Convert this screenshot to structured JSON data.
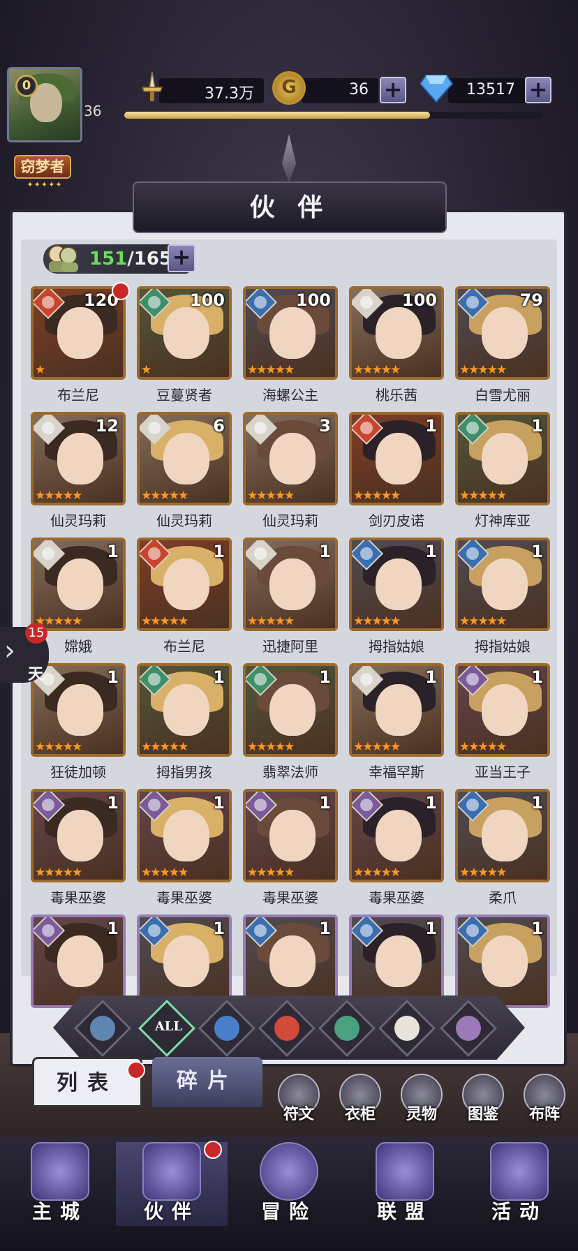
{
  "player": {
    "avatar_level": "0",
    "title": "窃梦者",
    "level": "36",
    "xp_progress": 0.73
  },
  "resources": {
    "power": "37.3万",
    "gold": "36",
    "gems": "13517"
  },
  "page_title": "伙 伴",
  "companion_count": {
    "current": "151",
    "max": "/165"
  },
  "side_tab": {
    "badge": "15",
    "label": "天"
  },
  "heroes": [
    {
      "name": "布兰尼",
      "level": "120",
      "stars": "★",
      "element": "fire",
      "dot": true
    },
    {
      "name": "豆蔓贤者",
      "level": "100",
      "stars": "★",
      "element": "wind",
      "dot": false
    },
    {
      "name": "海螺公主",
      "level": "100",
      "stars": "★★★★★",
      "element": "water",
      "dot": false
    },
    {
      "name": "桃乐茜",
      "level": "100",
      "stars": "★★★★★",
      "element": "light",
      "dot": false
    },
    {
      "name": "白雪尤丽",
      "level": "79",
      "stars": "★★★★★",
      "element": "water",
      "dot": false
    },
    {
      "name": "仙灵玛莉",
      "level": "12",
      "stars": "★★★★★",
      "element": "light",
      "dot": false
    },
    {
      "name": "仙灵玛莉",
      "level": "6",
      "stars": "★★★★★",
      "element": "light",
      "dot": false
    },
    {
      "name": "仙灵玛莉",
      "level": "3",
      "stars": "★★★★★",
      "element": "light",
      "dot": false
    },
    {
      "name": "剑刃皮诺",
      "level": "1",
      "stars": "★★★★★",
      "element": "fire",
      "dot": false
    },
    {
      "name": "灯神库亚",
      "level": "1",
      "stars": "★★★★★",
      "element": "wind",
      "dot": false
    },
    {
      "name": "嫦娥",
      "level": "1",
      "stars": "★★★★★",
      "element": "light",
      "dot": false
    },
    {
      "name": "布兰尼",
      "level": "1",
      "stars": "★★★★★",
      "element": "fire",
      "dot": false
    },
    {
      "name": "迅捷阿里",
      "level": "1",
      "stars": "★★★★★",
      "element": "light",
      "dot": false
    },
    {
      "name": "拇指姑娘",
      "level": "1",
      "stars": "★★★★★",
      "element": "water",
      "dot": false
    },
    {
      "name": "拇指姑娘",
      "level": "1",
      "stars": "★★★★★",
      "element": "water",
      "dot": false
    },
    {
      "name": "狂徒加顿",
      "level": "1",
      "stars": "★★★★★",
      "element": "light",
      "dot": false
    },
    {
      "name": "拇指男孩",
      "level": "1",
      "stars": "★★★★★",
      "element": "wind",
      "dot": false
    },
    {
      "name": "翡翠法师",
      "level": "1",
      "stars": "★★★★★",
      "element": "wind",
      "dot": false
    },
    {
      "name": "幸福罕斯",
      "level": "1",
      "stars": "★★★★★",
      "element": "light",
      "dot": false
    },
    {
      "name": "亚当王子",
      "level": "1",
      "stars": "★★★★★",
      "element": "dark",
      "dot": false
    },
    {
      "name": "毒果巫婆",
      "level": "1",
      "stars": "★★★★★",
      "element": "dark",
      "dot": false
    },
    {
      "name": "毒果巫婆",
      "level": "1",
      "stars": "★★★★★",
      "element": "dark",
      "dot": false
    },
    {
      "name": "毒果巫婆",
      "level": "1",
      "stars": "★★★★★",
      "element": "dark",
      "dot": false
    },
    {
      "name": "毒果巫婆",
      "level": "1",
      "stars": "★★★★★",
      "element": "dark",
      "dot": false
    },
    {
      "name": "柔爪",
      "level": "1",
      "stars": "★★★★★",
      "element": "water",
      "dot": false
    },
    {
      "name": "",
      "level": "1",
      "stars": "",
      "element": "dark",
      "dot": false
    },
    {
      "name": "",
      "level": "1",
      "stars": "",
      "element": "water",
      "dot": false
    },
    {
      "name": "",
      "level": "1",
      "stars": "",
      "element": "water",
      "dot": false
    },
    {
      "name": "",
      "level": "1",
      "stars": "",
      "element": "water",
      "dot": false
    },
    {
      "name": "",
      "level": "1",
      "stars": "",
      "element": "water",
      "dot": false
    }
  ],
  "filters": [
    {
      "name": "filter-class",
      "label": "",
      "color": "#5e86b0"
    },
    {
      "name": "filter-all",
      "label": "ALL",
      "color": "#7ee0a8",
      "active": true
    },
    {
      "name": "filter-water",
      "label": "",
      "color": "#4a7ec8"
    },
    {
      "name": "filter-fire",
      "label": "",
      "color": "#d24a3a"
    },
    {
      "name": "filter-wind",
      "label": "",
      "color": "#4aa080"
    },
    {
      "name": "filter-light",
      "label": "",
      "color": "#e8e4dc"
    },
    {
      "name": "filter-dark",
      "label": "",
      "color": "#9a7ab8"
    }
  ],
  "tabs": {
    "list": "列表",
    "shards": "碎片"
  },
  "sub_buttons": [
    "符文",
    "衣柜",
    "灵物",
    "图鉴",
    "布阵"
  ],
  "nav": [
    "主城",
    "伙伴",
    "冒险",
    "联盟",
    "活动"
  ],
  "element_colors": {
    "fire": "#c8442c",
    "wind": "#3e8e6a",
    "water": "#3a6eb0",
    "light": "#d8d4cc",
    "dark": "#7a5a9a"
  }
}
